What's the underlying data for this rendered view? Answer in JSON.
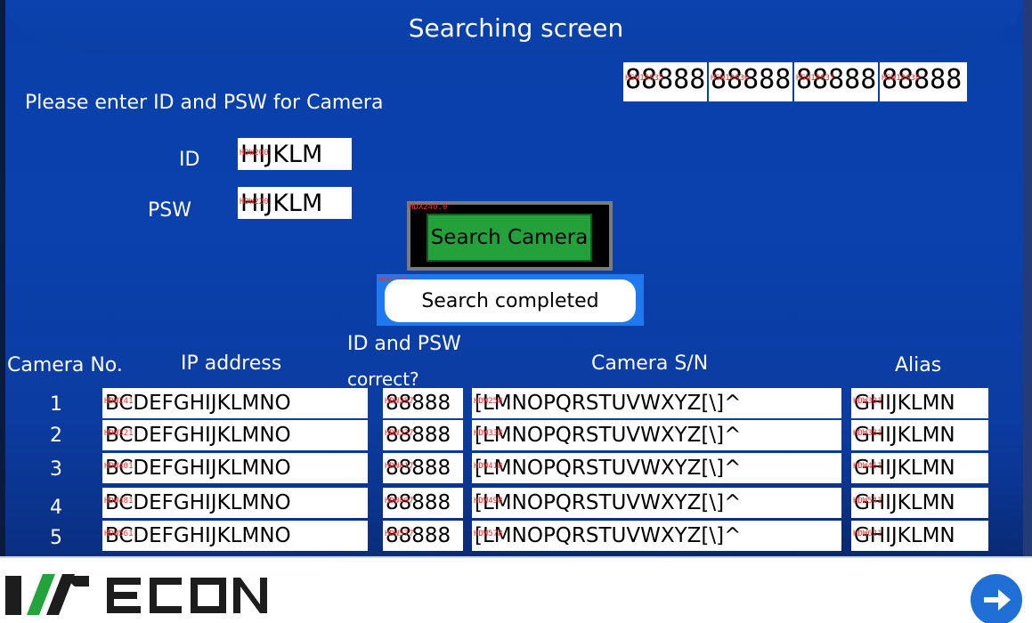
{
  "screen": {
    "title": "Searching screen"
  },
  "prompt": "Please enter ID and PSW for Camera",
  "top_values": [
    {
      "tag": "HSW10035",
      "value": "88888"
    },
    {
      "tag": "HSW10036",
      "value": "88888"
    },
    {
      "tag": "HSW10037",
      "value": "88888"
    },
    {
      "tag": "HSW10038",
      "value": "88888"
    }
  ],
  "id_field": {
    "label": "ID",
    "tag": "HDW200",
    "value": "HIJKLM"
  },
  "psw_field": {
    "label": "PSW",
    "tag": "HDW220",
    "value": "HIJKLM"
  },
  "search_button": {
    "tag": "HDX240.0",
    "label": "Search Camera"
  },
  "status": {
    "tag": "HDX240.1",
    "text": "Search completed"
  },
  "table": {
    "headers": {
      "camera_no": "Camera No.",
      "ip": "IP address",
      "id_psw_line1": "ID and PSW",
      "id_psw_line2": "correct?",
      "sn": "Camera S/N",
      "alias": "Alias"
    },
    "rows": [
      {
        "no": "1",
        "ip_tag": "HDW241",
        "ip": "BCDEFGHIJKLMNO",
        "ok_tag": "HDW257",
        "ok": "88888",
        "sn_tag": "HDW258",
        "sn": "[LMNOPQRSTUVWXYZ[\\]^",
        "alias_tag": "HDW301",
        "alias": "GHIJKLMN"
      },
      {
        "no": "2",
        "ip_tag": "HDW321",
        "ip": "BCDEFGHIJKLMNO",
        "ok_tag": "HDW337",
        "ok": "88888",
        "sn_tag": "HDW338",
        "sn": "[LMNOPQRSTUVWXYZ[\\]^",
        "alias_tag": "HDW381",
        "alias": "GHIJKLMN"
      },
      {
        "no": "3",
        "ip_tag": "HDW401",
        "ip": "BCDEFGHIJKLMNO",
        "ok_tag": "HDW417",
        "ok": "88888",
        "sn_tag": "HDW418",
        "sn": "[LMNOPQRSTUVWXYZ[\\]^",
        "alias_tag": "HDW461",
        "alias": "GHIJKLMN"
      },
      {
        "no": "4",
        "ip_tag": "HDW481",
        "ip": "BCDEFGHIJKLMNO",
        "ok_tag": "HDW497",
        "ok": "88888",
        "sn_tag": "HDW498",
        "sn": "[LMNOPQRSTUVWXYZ[\\]^",
        "alias_tag": "HDW541",
        "alias": "GHIJKLMN"
      },
      {
        "no": "5",
        "ip_tag": "HDW561",
        "ip": "BCDEFGHIJKLMNO",
        "ok_tag": "HDW577",
        "ok": "88888",
        "sn_tag": "HDW578",
        "sn": "[LMNOPQRSTUVWXYZ[\\]^",
        "alias_tag": "HDW621",
        "alias": "GHIJKLMN"
      }
    ]
  },
  "footer": {
    "logo_icon": "wecon-logo-icon",
    "next_icon": "arrow-right-icon"
  },
  "colors": {
    "background": "#0a41ad",
    "button_green": "#25a13b",
    "status_blue": "#1e78f0",
    "tag_red": "#ff2b2b"
  }
}
